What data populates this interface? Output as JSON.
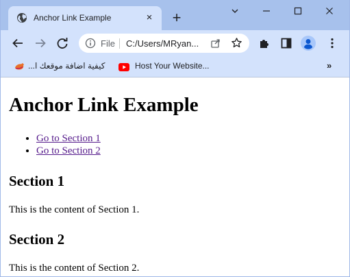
{
  "browser": {
    "tab": {
      "title": "Anchor Link Example",
      "close_glyph": "×"
    },
    "new_tab_glyph": "+",
    "omnibox": {
      "scheme": "File",
      "url": "C:/Users/MRyan..."
    },
    "bookmarks": [
      {
        "label": "كيفية اضافة موقعك ا...",
        "icon": "bookmark-favicon"
      },
      {
        "label": "Host Your Website...",
        "icon": "youtube-icon"
      }
    ],
    "bookmarks_more": "»",
    "colors": {
      "tab_strip": "#a7c1ec",
      "toolbar": "#d3e2fc",
      "link_visited": "#551a8b"
    }
  },
  "page": {
    "heading": "Anchor Link Example",
    "links": [
      {
        "label": "Go to Section 1"
      },
      {
        "label": "Go to Section 2"
      }
    ],
    "sections": [
      {
        "title": "Section 1",
        "content": "This is the content of Section 1."
      },
      {
        "title": "Section 2",
        "content": "This is the content of Section 2."
      }
    ]
  }
}
